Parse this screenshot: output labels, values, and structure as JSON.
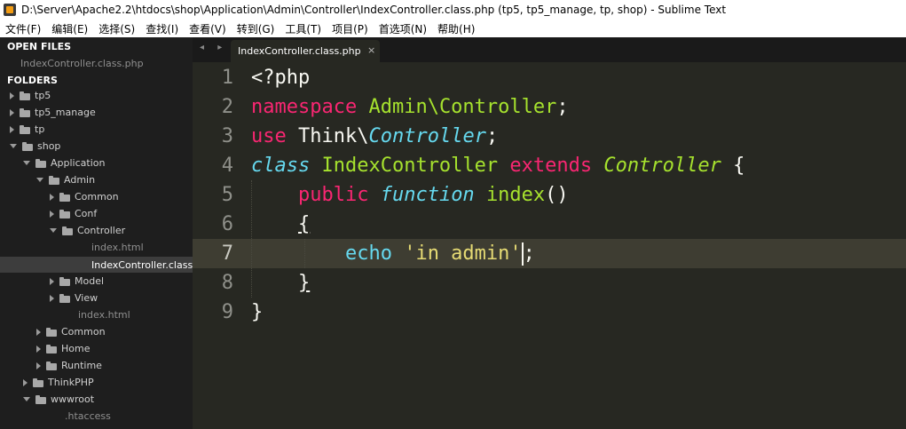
{
  "window": {
    "title": "D:\\Server\\Apache2.2\\htdocs\\shop\\Application\\Admin\\Controller\\IndexController.class.php (tp5, tp5_manage, tp, shop) - Sublime Text"
  },
  "menu": [
    "文件(F)",
    "编辑(E)",
    "选择(S)",
    "查找(I)",
    "查看(V)",
    "转到(G)",
    "工具(T)",
    "项目(P)",
    "首选项(N)",
    "帮助(H)"
  ],
  "sidebar": {
    "open_files_header": "OPEN FILES",
    "open_file": "IndexController.class.php",
    "folders_header": "FOLDERS",
    "tree": [
      {
        "label": "tp5",
        "kind": "folder",
        "expanded": false
      },
      {
        "label": "tp5_manage",
        "kind": "folder",
        "expanded": false
      },
      {
        "label": "tp",
        "kind": "folder",
        "expanded": false
      },
      {
        "label": "shop",
        "kind": "folder",
        "expanded": true
      },
      {
        "label": "Application",
        "kind": "folder",
        "expanded": true
      },
      {
        "label": "Admin",
        "kind": "folder",
        "expanded": true
      },
      {
        "label": "Common",
        "kind": "folder",
        "expanded": false
      },
      {
        "label": "Conf",
        "kind": "folder",
        "expanded": false
      },
      {
        "label": "Controller",
        "kind": "folder",
        "expanded": true
      },
      {
        "label": "index.html",
        "kind": "file"
      },
      {
        "label": "IndexController.class.p",
        "kind": "file",
        "selected": true
      },
      {
        "label": "Model",
        "kind": "folder",
        "expanded": false
      },
      {
        "label": "View",
        "kind": "folder",
        "expanded": false
      },
      {
        "label": "index.html",
        "kind": "file"
      },
      {
        "label": "Common",
        "kind": "folder",
        "expanded": false
      },
      {
        "label": "Home",
        "kind": "folder",
        "expanded": false
      },
      {
        "label": "Runtime",
        "kind": "folder",
        "expanded": false
      },
      {
        "label": "ThinkPHP",
        "kind": "folder",
        "expanded": false
      },
      {
        "label": "wwwroot",
        "kind": "folder",
        "expanded": true
      },
      {
        "label": ".htaccess",
        "kind": "file"
      }
    ]
  },
  "tabs": {
    "nav": "◂ ▸",
    "active_label": "IndexController.class.php",
    "close": "×"
  },
  "editor": {
    "line_numbers": [
      "1",
      "2",
      "3",
      "4",
      "5",
      "6",
      "7",
      "8",
      "9"
    ],
    "code": {
      "l1": "<?php",
      "l2_kw": "namespace",
      "l2_ns": "Admin\\Controller",
      "l2_semi": ";",
      "l3_kw": "use",
      "l3_a": "Think\\",
      "l3_b": "Controller",
      "l3_semi": ";",
      "l4_kw": "class",
      "l4_name": "IndexController",
      "l4_ext": "extends",
      "l4_parent": "Controller",
      "l4_brace": "{",
      "l5_kw": "public",
      "l5_fn": "function",
      "l5_name": "index",
      "l5_parens": "()",
      "l6": "{",
      "l7_echo": "echo",
      "l7_str": "'in admin'",
      "l7_semi": ";",
      "l8": "}",
      "l9": "}"
    },
    "colors": {
      "background": "#272822",
      "keyword": "#f92672",
      "class": "#a6e22e",
      "storage": "#66d9ef",
      "string": "#e6db74",
      "text": "#f8f8f2"
    }
  },
  "icons": {
    "app": "sublime-text-icon",
    "folder": "folder-icon",
    "expand": "chevron-right-icon",
    "collapse": "chevron-down-icon",
    "close": "close-icon"
  }
}
